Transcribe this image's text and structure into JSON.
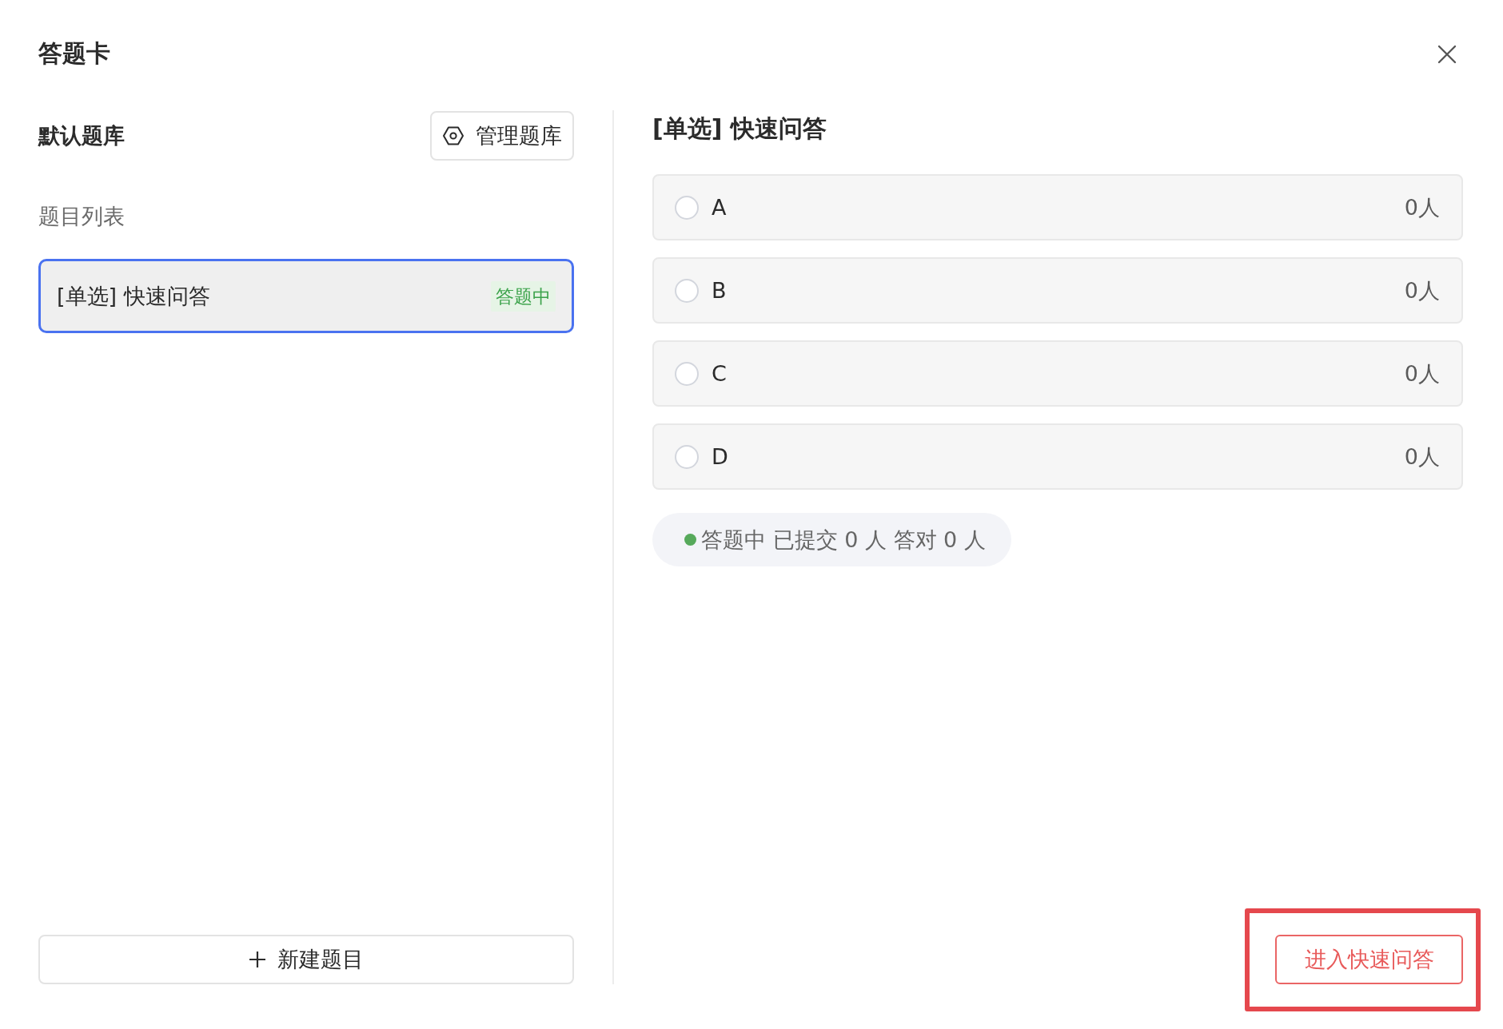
{
  "dialog": {
    "title": "答题卡"
  },
  "library": {
    "name": "默认题库",
    "manage_button": "管理题库"
  },
  "question_list": {
    "label": "题目列表",
    "items": [
      {
        "title": "[单选] 快速问答",
        "status": "答题中",
        "selected": true
      }
    ]
  },
  "new_question_button": "新建题目",
  "question": {
    "title": "[单选] 快速问答",
    "options": [
      {
        "label": "A",
        "count": "0人",
        "selected": false
      },
      {
        "label": "B",
        "count": "0人",
        "selected": false
      },
      {
        "label": "C",
        "count": "0人",
        "selected": false
      },
      {
        "label": "D",
        "count": "0人",
        "selected": false
      }
    ]
  },
  "status": {
    "text": "答题中 已提交 0 人 答对 0 人"
  },
  "start_button": {
    "label": "进入快速问答",
    "highlighted": true
  }
}
